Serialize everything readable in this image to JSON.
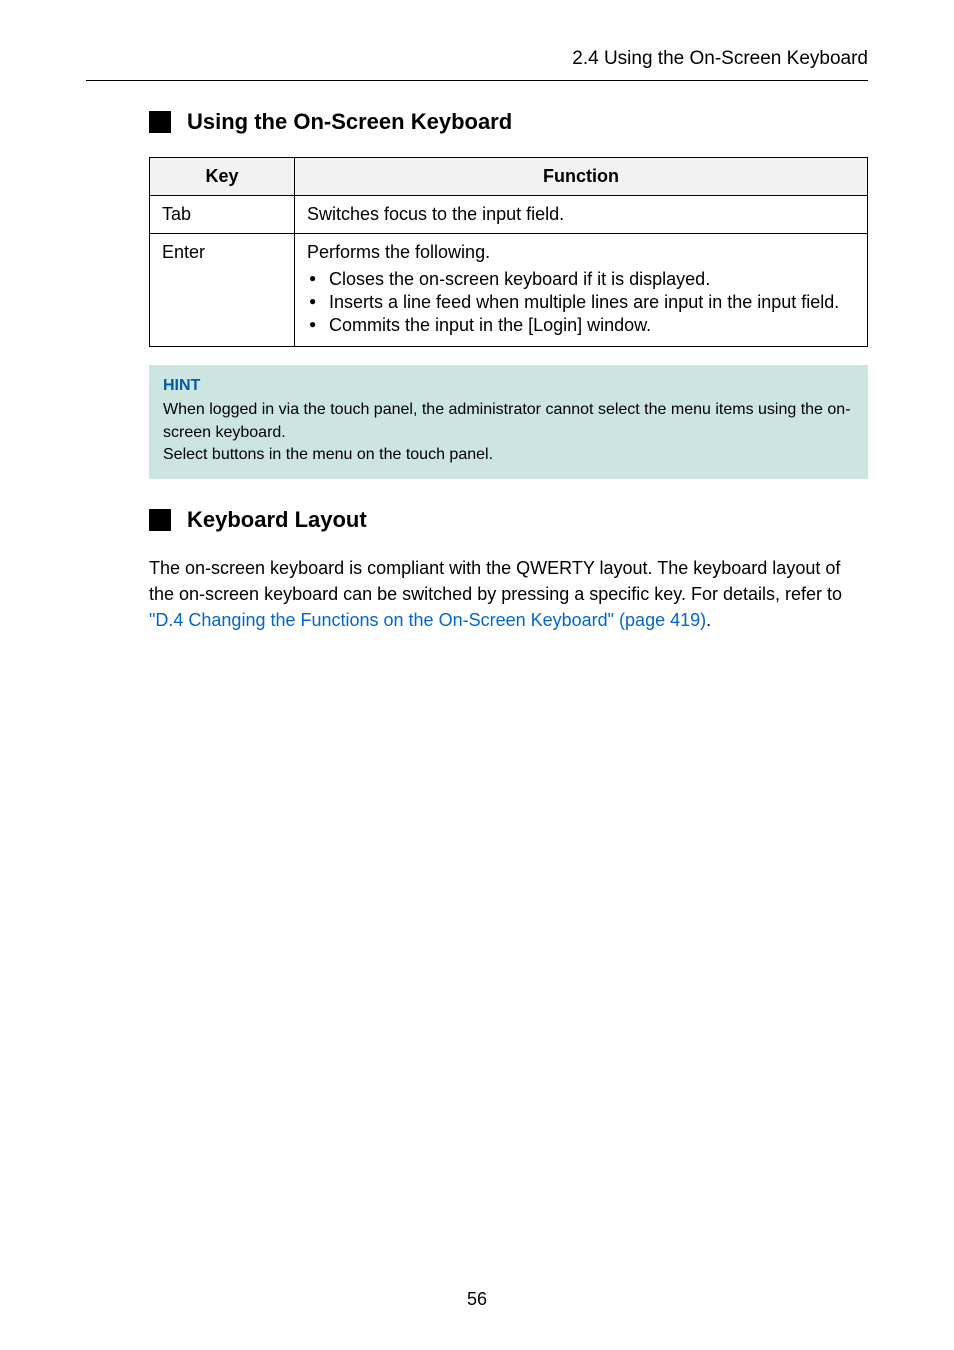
{
  "header": {
    "breadcrumb": "2.4 Using the On-Screen Keyboard"
  },
  "section1": {
    "title": "Using the On-Screen Keyboard",
    "table": {
      "headers": {
        "key": "Key",
        "function": "Function"
      },
      "rows": [
        {
          "key": "Tab",
          "function_intro": "Switches focus to the input field.",
          "bullets": []
        },
        {
          "key": "Enter",
          "function_intro": "Performs the following.",
          "bullets": [
            "Closes the on-screen keyboard if it is displayed.",
            "Inserts a line feed when multiple lines are input in the input field.",
            "Commits the input in the [Login] window."
          ]
        }
      ]
    }
  },
  "hint": {
    "label": "HINT",
    "line1": "When logged in via the touch panel, the administrator cannot select the menu items using the on-screen keyboard.",
    "line2": "Select buttons in the menu on the touch panel."
  },
  "section2": {
    "title": "Keyboard Layout",
    "para_before": "The on-screen keyboard is compliant with the QWERTY layout.\nThe keyboard layout of the on-screen keyboard can be switched by pressing a specific key. For details, refer to ",
    "link_text": "\"D.4 Changing the Functions on the On-Screen Keyboard\" (page 419)",
    "para_after": "."
  },
  "page_number": "56"
}
